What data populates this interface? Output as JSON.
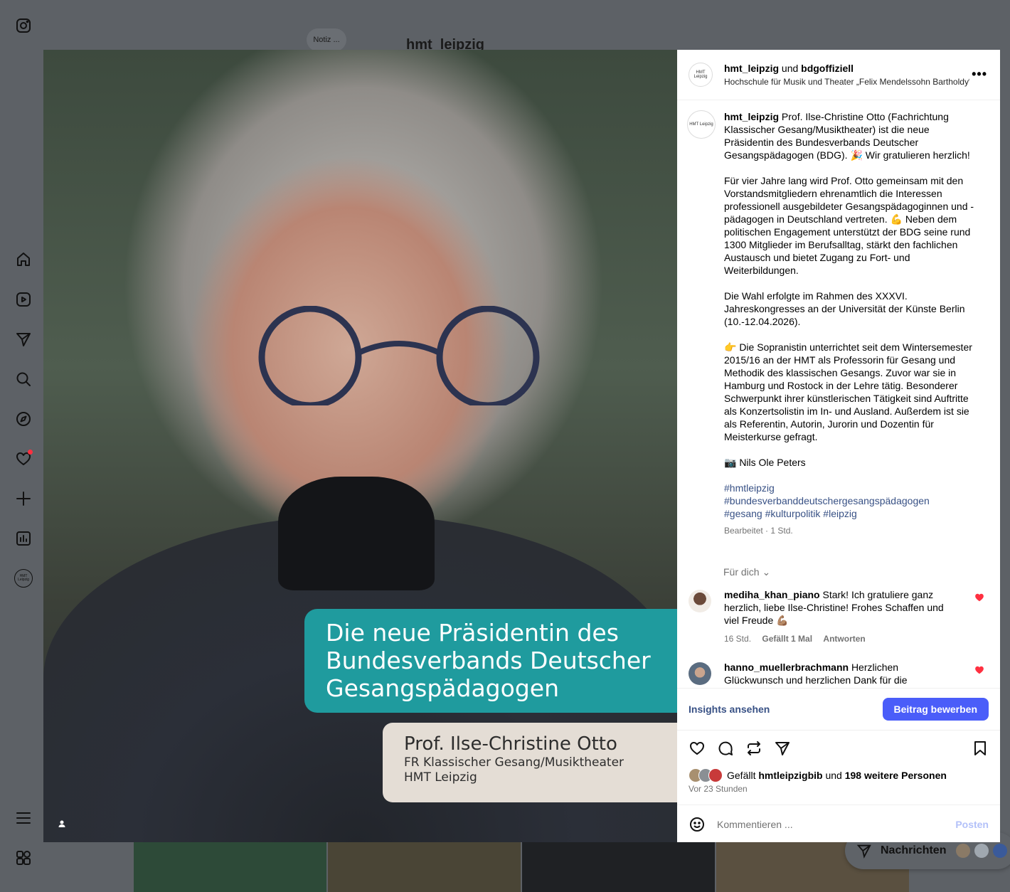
{
  "sidebar": {
    "avatar_text": "HMT Leipzig"
  },
  "background": {
    "note": "Notiz ...",
    "username": "hmt_leipzig",
    "messages_label": "Nachrichten"
  },
  "photo": {
    "headline_lines": [
      "Die neue Präsidentin des",
      "Bundesverbands Deutscher",
      "Gesangspädagogen"
    ],
    "name": "Prof. Ilse-Christine Otto",
    "role": "FR Klassischer Gesang/Musiktheater",
    "org": "HMT Leipzig"
  },
  "post": {
    "author": "hmt_leipzig",
    "connector": "und",
    "collaborator": "bdgoffiziell",
    "subtitle": "Hochschule für Musik und Theater „Felix Mendelssohn Bartholdy“ Leipzig",
    "avatar_text": "HMT Leipzig",
    "caption_p1": "Prof. Ilse-Christine Otto (Fachrichtung Klassischer Gesang/Musiktheater) ist die neue Präsidentin des Bundesverbands Deutscher Gesangspädagogen (BDG). 🎉 Wir gratulieren herzlich!",
    "caption_p2": "Für vier Jahre lang wird Prof. Otto gemeinsam mit den Vorstandsmitgliedern ehrenamtlich die Interessen professionell ausgebildeter Gesangspädagoginnen und -pädagogen in Deutschland vertreten. 💪 Neben dem politischen Engagement unterstützt der BDG seine rund 1300 Mitglieder im Berufsalltag, stärkt den fachlichen Austausch und bietet Zugang zu Fort- und Weiterbildungen.",
    "caption_p3": "Die Wahl erfolgte im Rahmen des XXXVI. Jahreskongresses an der Universität der Künste Berlin (10.-12.04.2026).",
    "caption_p4": "👉 Die Sopranistin unterrichtet seit dem Wintersemester 2015/16 an der HMT als Professorin für Gesang und Methodik des klassischen Gesangs. Zuvor war sie in Hamburg und Rostock in der Lehre tätig. Besonderer Schwerpunkt ihrer künstlerischen Tätigkeit sind Auftritte als Konzertsolistin im In- und Ausland. Außerdem ist sie als Referentin, Autorin, Jurorin und Dozentin für Meisterkurse gefragt.",
    "caption_p5": "📷 Nils Ole Peters",
    "hashtag_1": "#hmtleipzig",
    "hashtag_2": "#bundesverbanddeutschergesangspädagogen",
    "hashtag_3": "#gesang #kulturpolitik #leipzig",
    "meta": "Bearbeitet · 1 Std.",
    "filter": "Für dich"
  },
  "comments": [
    {
      "user": "mediha_khan_piano",
      "text": "Stark! Ich gratuliere ganz herzlich, liebe Ilse-Christine! Frohes Schaffen und viel Freude 💪🏽",
      "time": "16 Std.",
      "likes": "Gefällt 1 Mal",
      "reply": "Antworten"
    },
    {
      "user": "hanno_muellerbrachmann",
      "text": "Herzlichen Glückwunsch und herzlichen Dank für die ehrenamtliche Arbeit🙏👏"
    }
  ],
  "actions": {
    "insights": "Insights ansehen",
    "promote": "Beitrag bewerben"
  },
  "likes": {
    "prefix": "Gefällt",
    "user": "hmtleipzigbib",
    "connector": "und",
    "others": "198 weitere Personen",
    "ago": "Vor 23 Stunden"
  },
  "comment_input": {
    "placeholder": "Kommentieren ...",
    "post": "Posten"
  },
  "colors": {
    "accent": "#4a5df9",
    "teal": "#1f9b9e",
    "link": "#385185",
    "like": "#ff3040"
  }
}
